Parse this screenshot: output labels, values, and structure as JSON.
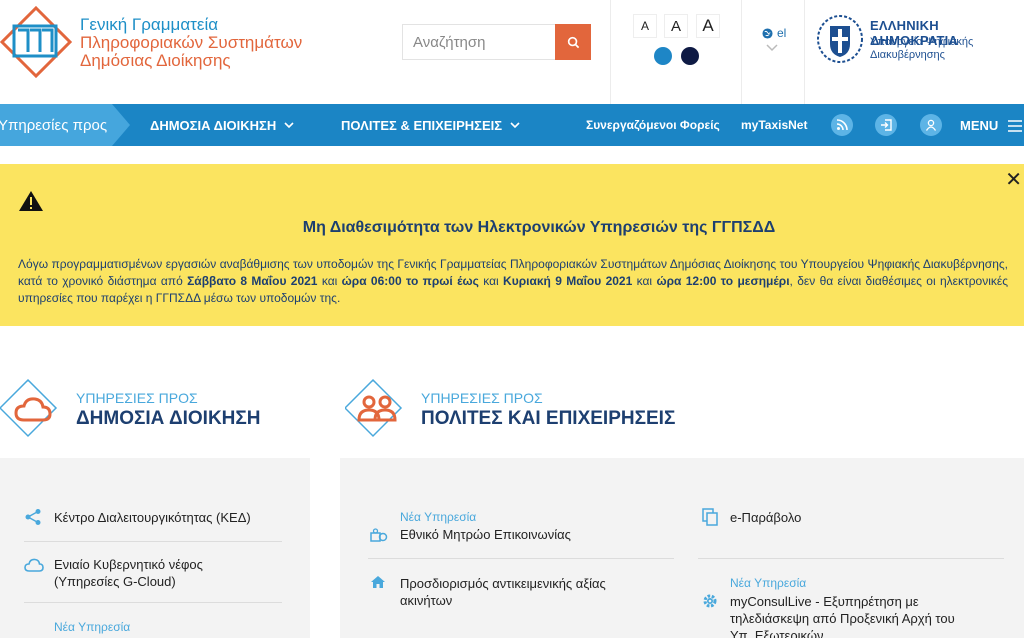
{
  "header": {
    "org_name": [
      "Γενική Γραμματεία",
      "Πληροφοριακών Συστημάτων",
      "Δημόσιας Διοίκησης"
    ],
    "search_placeholder": "Αναζήτηση",
    "font_sizes": [
      "A",
      "A",
      "A"
    ],
    "language": "el",
    "gov_title": "ΕΛΛΗΝΙΚΗ ΔΗΜΟΚΡΑΤΙΑ",
    "gov_sub": [
      "Υπουργείο Ψηφιακής",
      "Διακυβέρνησης"
    ],
    "colors": {
      "brand_orange": "#e2663c",
      "brand_blue": "#1b85c5",
      "navy": "#1d3f70",
      "contrast_a": "#1e86c6",
      "contrast_b": "#0e1a44"
    }
  },
  "nav": {
    "lead": "Υπηρεσίες προς",
    "items": [
      "ΔΗΜΟΣΙΑ ΔΙΟΙΚΗΣΗ",
      "ΠΟΛΙΤΕΣ & ΕΠΙΧΕΙΡΗΣΕΙΣ"
    ],
    "links": [
      "Συνεργαζόμενοι Φορείς",
      "myTaxisNet"
    ],
    "menu": "MENU"
  },
  "alert": {
    "title": "Μη Διαθεσιμότητα των Ηλεκτρονικών Υπηρεσιών της ΓΓΠΣΔΔ",
    "p1": "Λόγω προγραμματισμένων εργασιών αναβάθμισης των υποδομών της Γενικής Γραμματείας Πληροφοριακών Συστημάτων Δημόσιας Διοίκησης του Υπουργείου Ψηφιακής Διακυβέρνησης, κατά το χρονικό διάστημα από ",
    "b1": "Σάββατο 8 Μαΐου 2021",
    "p2": " και ",
    "b2": "ώρα 06:00 το πρωί έως",
    "p3": " και ",
    "b3": "Κυριακή 9 Μαΐου 2021",
    "p4": " και ",
    "b4": "ώρα 12:00 το μεσημέρι",
    "p5": ", δεν θα είναι διαθέσιμες οι ηλεκτρονικές υπηρεσίες που παρέχει η ΓΓΠΣΔΔ μέσω των υποδομών της."
  },
  "sections": {
    "public": {
      "pre": "ΥΠΗΡΕΣΙΕΣ ΠΡΟΣ",
      "title": "ΔΗΜΟΣΙΑ ΔΙΟΙΚΗΣΗ",
      "items": [
        {
          "label": "Κέντρο Διαλειτουργικότητας (ΚΕΔ)"
        },
        {
          "label": "Ενιαίο Κυβερνητικό νέφος",
          "label2": "(Υπηρεσίες G-Cloud)"
        },
        {
          "tag": "Νέα Υπηρεσία"
        }
      ]
    },
    "citizens": {
      "pre": "ΥΠΗΡΕΣΙΕΣ ΠΡΟΣ",
      "title": "ΠΟΛΙΤΕΣ ΚΑΙ ΕΠΙΧΕΙΡΗΣΕΙΣ",
      "left": [
        {
          "tag": "Νέα Υπηρεσία",
          "label": "Εθνικό Μητρώο Επικοινωνίας"
        },
        {
          "label": "Προσδιορισμός αντικειμενικής αξίας",
          "label2": "ακινήτων"
        }
      ],
      "right": [
        {
          "label": "e-Παράβολο"
        },
        {
          "tag": "Νέα Υπηρεσία",
          "label": "myConsulLive - Εξυπηρέτηση με",
          "label2": "τηλεδιάσκεψη από Προξενική Αρχή του",
          "label3": "Υπ. Εξωτερικών"
        }
      ]
    }
  }
}
